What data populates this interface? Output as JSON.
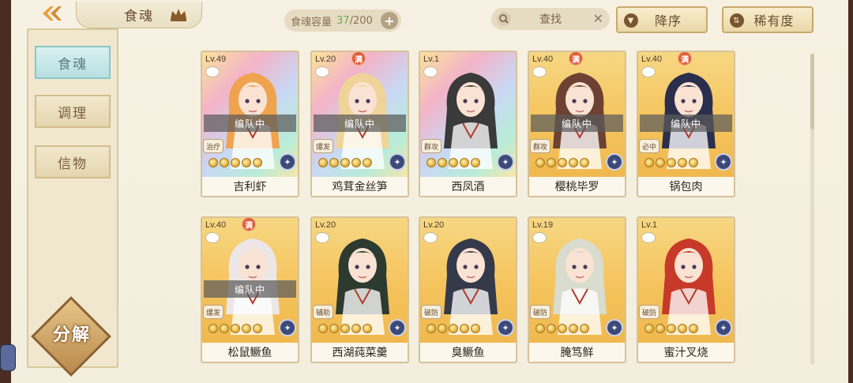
{
  "header": {
    "tab_title": "食魂",
    "capacity_label": "食魂容量",
    "capacity_current": "37",
    "capacity_total": "/200",
    "search_label": "查找",
    "sort_desc_label": "降序",
    "sort_rarity_label": "稀有度"
  },
  "sidebar": {
    "items": [
      {
        "label": "食魂",
        "active": true
      },
      {
        "label": "调理",
        "active": false
      },
      {
        "label": "信物",
        "active": false
      }
    ],
    "decompose_label": "分解"
  },
  "cards": [
    {
      "level": "Lv.49",
      "name": "吉利虾",
      "role": "治疗",
      "team": "编队中",
      "full": false,
      "frame": "rainbow",
      "stars": 5,
      "hair": "#f0a34e"
    },
    {
      "level": "Lv.20",
      "name": "鸡茸金丝笋",
      "role": "爆发",
      "team": "编队中",
      "full": true,
      "frame": "rainbow",
      "stars": 5,
      "hair": "#efd49a"
    },
    {
      "level": "Lv.1",
      "name": "西凤酒",
      "role": "群攻",
      "team": "",
      "full": false,
      "frame": "rainbow",
      "stars": 5,
      "hair": "#3b3a3a"
    },
    {
      "level": "Lv.40",
      "name": "樱桃毕罗",
      "role": "群攻",
      "team": "编队中",
      "full": true,
      "frame": "gold",
      "stars": 5,
      "hair": "#6d4232"
    },
    {
      "level": "Lv.40",
      "name": "锅包肉",
      "role": "必中",
      "team": "编队中",
      "full": true,
      "frame": "gold",
      "stars": 5,
      "hair": "#2b2f4d"
    },
    {
      "level": "Lv.40",
      "name": "松鼠鳜鱼",
      "role": "爆发",
      "team": "编队中",
      "full": true,
      "frame": "gold",
      "stars": 5,
      "hair": "#ece7e6"
    },
    {
      "level": "Lv.20",
      "name": "西湖莼菜羹",
      "role": "辅助",
      "team": "",
      "full": false,
      "frame": "gold",
      "stars": 5,
      "hair": "#2d3a30"
    },
    {
      "level": "Lv.20",
      "name": "臭鳜鱼",
      "role": "破防",
      "team": "",
      "full": false,
      "frame": "gold",
      "stars": 5,
      "hair": "#353a4a"
    },
    {
      "level": "Lv.19",
      "name": "腌笃鲜",
      "role": "破防",
      "team": "",
      "full": false,
      "frame": "gold",
      "stars": 5,
      "hair": "#d9dccf"
    },
    {
      "level": "Lv.1",
      "name": "蜜汁叉烧",
      "role": "破防",
      "team": "",
      "full": false,
      "frame": "gold",
      "stars": 5,
      "hair": "#c73a2a"
    }
  ],
  "full_badge_text": "满"
}
